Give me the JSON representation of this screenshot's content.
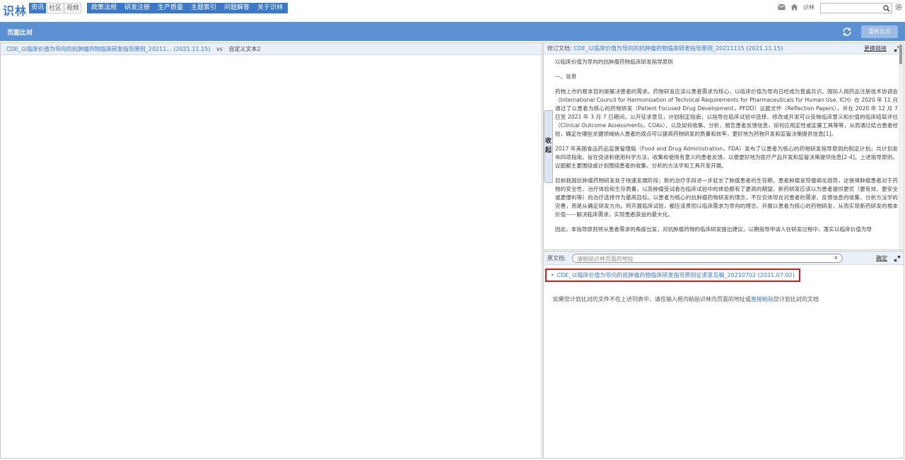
{
  "brand": {
    "logo": "识林",
    "color": "#3b78c6"
  },
  "segments": [
    {
      "label": "资讯",
      "active": true
    },
    {
      "label": "社区",
      "active": false
    },
    {
      "label": "视频",
      "active": false
    }
  ],
  "nav": [
    "政策法规",
    "研发注册",
    "生产质量",
    "主题索引",
    "问题解答",
    "关于识林"
  ],
  "topright": {
    "mail_icon": "mail-icon",
    "home_icon": "home-icon",
    "user_label": "识林",
    "search_placeholder": "",
    "search_icon": "search-icon",
    "settings_icon": "gear-icon"
  },
  "compare_header": {
    "title": "页面比对",
    "sync_icon": "sync-icon",
    "recompare_label": "重新比对"
  },
  "left_pane": {
    "doc_title": "CDE_以临床价值为导向的抗肿瘤药物临床研发指导原则_20211... (2021.11.15)",
    "vs": "vs",
    "other": "自定义文本2"
  },
  "collapse_label": [
    "收",
    "起"
  ],
  "revision_pane": {
    "label": "修订文档:",
    "doc_title": "CDE_以临床价值为导向的抗肿瘤药物临床研发指导原则_20211115 (2021.11.15)",
    "change_link": "更换链接",
    "expand_icon": "expand-icon",
    "body": [
      "以临床价值为导向的抗肿瘤药物临床研发指导原则",
      "一、背景",
      "药物上市的根本目的是解决患者的需求。药物研发应该以患者需求为核心，以临床价值为导向已经成为普遍共识。国际人用药品注册技术协调会（International Council for Harmonisation of Technical Requirements for Pharmaceuticals for Human Use, ICH）在 2020 年 11 月通过了以患者为核心的药物研发（Patient Focused Drug Development，PFDD）议题文件（Reflection Papers），并在 2020 年 12 月 7 日至 2021 年 3 月 7 日期间，公开征求意见，计划制定指南，以指导在临床试验中选择、修改或开发可以反映临床意义和价值的临床结局评估（Clinical Outcome Assessments，COAs），以及如何收集、分析、报告患者反馈信息，如何应用定性或定量工具等等，从而通过结合患者经验，确定在哪些关键领域纳入患者的观点可以提高药物研发的质量和效率，更好地为药物开发和监管决策提供信息[1]。",
      "2017 年美国食品药品监督管理局（Food and Drug Administration，FDA）发布了以患者为核心的药物研发指导原则的制定计划，共计划发布四项指南，旨在促进和使用科学方法，收集和使用有意义的患者反馈，以便更好地为医疗产品开发和监管决策提供信息[2-4]。上述指导原则，议题都主要围绕或计划围绕患者的收集、分析的方法学和工具开发开展。",
      "目前我国抗肿瘤药物研发处于快速发展阶段；新的治疗手段进一步延长了肿瘤患者的生存期，患者肿瘤呈现慢病化趋势，这使得肿瘤患者对于药物的安全性、治疗体验和生存质量，以及肿瘤受试者在临床试验中的体验都有了更高的期望。新药研发应该以为患者提供更优（更有效、更安全或更便利等）的治疗选择作为最高目标。以患者为核心的抗肿瘤药物研发的理念，不仅仅体现在对患者的需求、反馈信息的收集、分析方法学的完善，而是从确定研发方向，到开展临床试验，都应该贯彻以临床需求为导向的理念，开展以患者为核心的药物研发，从而实现新药研发的根本价值——解决临床需求，实现患者获益的最大化。",
      "因此，本指导原则将从患者需求的角度出发，对抗肿瘤药物的临床研发提出建议，以期指导申请人在研发过程中，落实以临床价值为导"
    ]
  },
  "original_pane": {
    "label": "原文档:",
    "input_placeholder": "请粘贴识林页面的地址",
    "clear_label": "x",
    "confirm_label": "确定",
    "expand_icon": "expand-icon",
    "item": "CDE_以临床价值为导向的抗肿瘤药物临床研发指导原则征求意见稿_20210702 (2021.07.02)",
    "hint_pre": "如果您计划比对的文件不在上述列表中，请在输入框内粘贴识林内页面的地址或",
    "hint_link": "直接粘贴",
    "hint_post": "您计划比对的文档"
  }
}
